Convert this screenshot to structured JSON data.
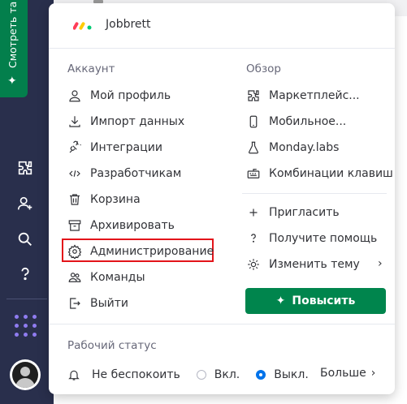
{
  "rail": {
    "see_plans_label": "Смотреть та",
    "icons": [
      "puzzle-icon",
      "add-user-icon",
      "search-icon",
      "help-icon",
      "apps-grid-icon",
      "avatar-icon"
    ]
  },
  "menu": {
    "brand": "Jobbrett",
    "account": {
      "title": "Аккаунт",
      "items": [
        {
          "label": "Мой профиль",
          "icon": "user-icon"
        },
        {
          "label": "Импорт данных",
          "icon": "download-icon"
        },
        {
          "label": "Интеграции",
          "icon": "plug-icon"
        },
        {
          "label": "Разработчикам",
          "icon": "code-icon"
        },
        {
          "label": "Корзина",
          "icon": "trash-icon"
        },
        {
          "label": "Архивировать",
          "icon": "archive-icon"
        },
        {
          "label": "Администрирование",
          "icon": "gear-icon"
        },
        {
          "label": "Команды",
          "icon": "team-icon"
        },
        {
          "label": "Выйти",
          "icon": "logout-icon"
        }
      ]
    },
    "overview": {
      "title": "Обзор",
      "items": [
        {
          "label": "Маркетплейс...",
          "icon": "puzzle-icon"
        },
        {
          "label": "Мобильное...",
          "icon": "phone-icon"
        },
        {
          "label": "Monday.labs",
          "icon": "flask-icon"
        },
        {
          "label": "Комбинации клавиш",
          "icon": "keyboard-icon"
        }
      ],
      "extra": [
        {
          "label": "Пригласить",
          "icon": "plus-icon"
        },
        {
          "label": "Получите помощь",
          "icon": "question-icon"
        },
        {
          "label": "Изменить тему",
          "icon": "sun-icon"
        }
      ]
    },
    "upgrade_label": "Повысить",
    "status": {
      "title": "Рабочий статус",
      "dnd_label": "Не беспокоить",
      "on_label": "Вкл.",
      "off_label": "Выкл.",
      "selected": "off",
      "more_label": "Больше"
    }
  },
  "colors": {
    "rail_bg": "#292f4c",
    "accent_green": "#00854d",
    "highlight_red": "#e3141a",
    "radio_blue": "#0073ea"
  }
}
